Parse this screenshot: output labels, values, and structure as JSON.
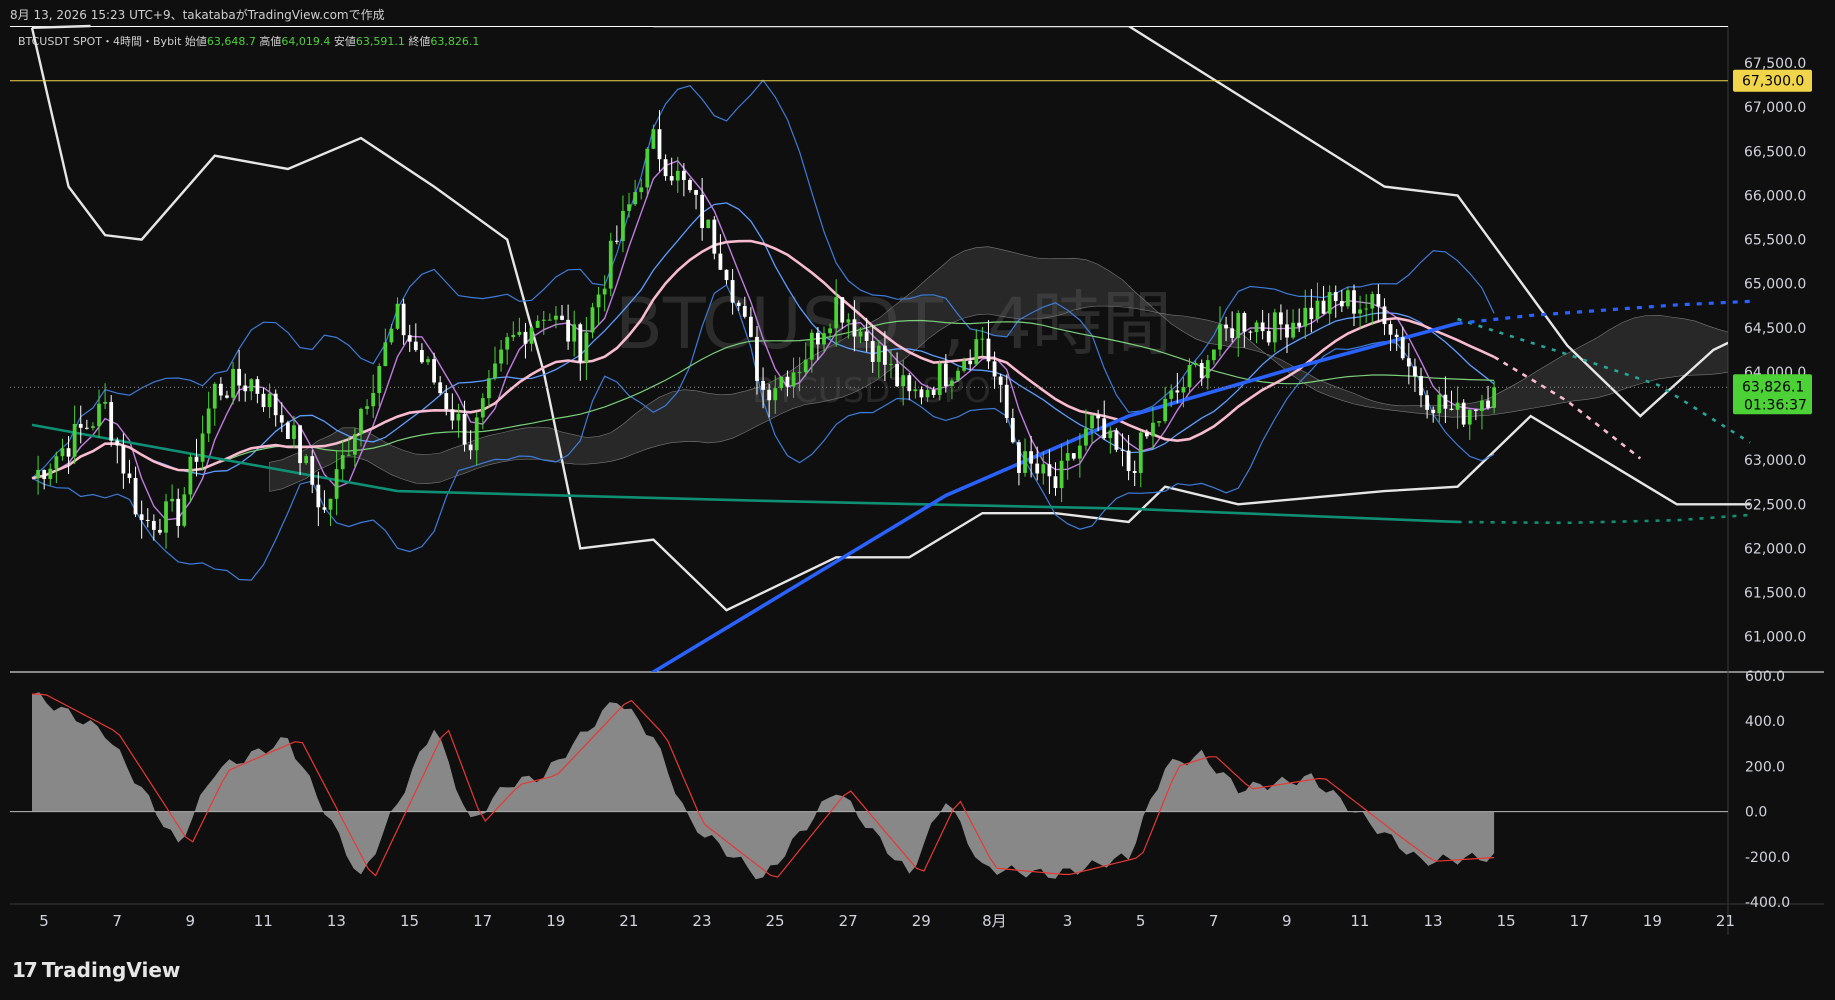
{
  "header": {
    "text": "8月 13, 2026 15:23 UTC+9、takatabaがTradingView.comで作成"
  },
  "symbol_info": {
    "name": "BTCUSDT SPOT・4時間・Bybit",
    "open_label": "始値",
    "open": "63,648.7",
    "high_label": "高値",
    "high": "64,019.4",
    "low_label": "安値",
    "low": "63,591.1",
    "close_label": "終値",
    "close": "63,826.1"
  },
  "watermark": {
    "main": "BTCUSDT, 4時間",
    "sub": "BTCUSDT SPOT"
  },
  "price_axis": {
    "ticks": [
      "67,500.0",
      "67,000.0",
      "66,500.0",
      "66,000.0",
      "65,500.0",
      "65,000.0",
      "64,500.0",
      "64,000.0",
      "63,000.0",
      "62,500.0",
      "62,000.0",
      "61,500.0",
      "61,000.0"
    ],
    "tick_values": [
      67500,
      67000,
      66500,
      66000,
      65500,
      65000,
      64500,
      64000,
      63000,
      62500,
      62000,
      61500,
      61000
    ],
    "level_label": "67,300.0",
    "level_value": 67300,
    "last_price": "63,826.1",
    "last_value": 63826.1,
    "countdown": "01:36:37"
  },
  "oscillator_axis": {
    "ticks": [
      "600.0",
      "400.0",
      "200.0",
      "0.0",
      "-200.0",
      "-400.0"
    ],
    "tick_values": [
      600,
      400,
      200,
      0,
      -200,
      -400
    ]
  },
  "time_axis": {
    "labels": [
      "5",
      "7",
      "9",
      "11",
      "13",
      "15",
      "17",
      "19",
      "21",
      "23",
      "25",
      "27",
      "29",
      "8月",
      "3",
      "5",
      "7",
      "9",
      "11",
      "13",
      "15",
      "17",
      "19",
      "21"
    ]
  },
  "colors": {
    "background": "#0f0f0f",
    "candle_up": "#4cd137",
    "candle_down": "#ffffff",
    "level_line": "#f0d54a",
    "last_price_badge": "#4cd137",
    "ema_blue": "#2962ff",
    "ma_pink": "#f8bbd0",
    "ma_teal": "#0f8f73",
    "bollinger": "#3d7bd8",
    "envelope": "#e6e6e6",
    "oscillator_fill": "#9e9e9e",
    "oscillator_signal": "#e53935"
  },
  "brand": {
    "name": "TradingView",
    "mark": "17"
  },
  "chart_data": {
    "type": "line",
    "title": "BTCUSDT SPOT・4時間・Bybit",
    "ylim": [
      60600,
      67920
    ],
    "x_range_days": [
      0,
      47
    ],
    "close_series": {
      "name": "BTCUSDT",
      "x": [
        0,
        1,
        2,
        3,
        4,
        5,
        6,
        7,
        8,
        9,
        10,
        11,
        12,
        13,
        14,
        15,
        16,
        17,
        18,
        19,
        20,
        21,
        22,
        23,
        24,
        25,
        26,
        27,
        28,
        29,
        30,
        31,
        32,
        33,
        34,
        35,
        36,
        37,
        38,
        39,
        40
      ],
      "y": [
        62800,
        63200,
        63600,
        62300,
        62400,
        63800,
        63900,
        63400,
        62400,
        63600,
        64600,
        63900,
        63200,
        64300,
        64700,
        64300,
        65500,
        66600,
        66000,
        65200,
        63800,
        64100,
        64800,
        64300,
        63700,
        64000,
        64400,
        63000,
        62700,
        63400,
        62900,
        63600,
        64100,
        64600,
        64500,
        64700,
        64800,
        64700,
        63800,
        63500,
        63826
      ]
    },
    "ma_teal": {
      "x": [
        0,
        10,
        20,
        30,
        39
      ],
      "y": [
        63400,
        62650,
        62540,
        62450,
        62300
      ]
    },
    "ema_blue": {
      "x": [
        17,
        25,
        30,
        35,
        39
      ],
      "y": [
        60600,
        62600,
        63500,
        64100,
        64550
      ]
    },
    "oscillator": {
      "ylim": [
        -400,
        600
      ],
      "x": [
        0,
        2,
        4,
        5,
        7,
        9,
        11,
        12,
        13,
        14,
        16,
        17,
        18,
        20,
        22,
        24,
        25,
        26,
        28,
        30,
        31,
        32,
        33,
        35,
        37,
        38,
        39,
        40
      ],
      "y": [
        520,
        350,
        -150,
        180,
        320,
        -300,
        380,
        -50,
        120,
        160,
        500,
        330,
        -50,
        -300,
        100,
        -280,
        60,
        -250,
        -280,
        -200,
        200,
        250,
        100,
        150,
        -100,
        -220,
        -210,
        -200
      ]
    }
  }
}
